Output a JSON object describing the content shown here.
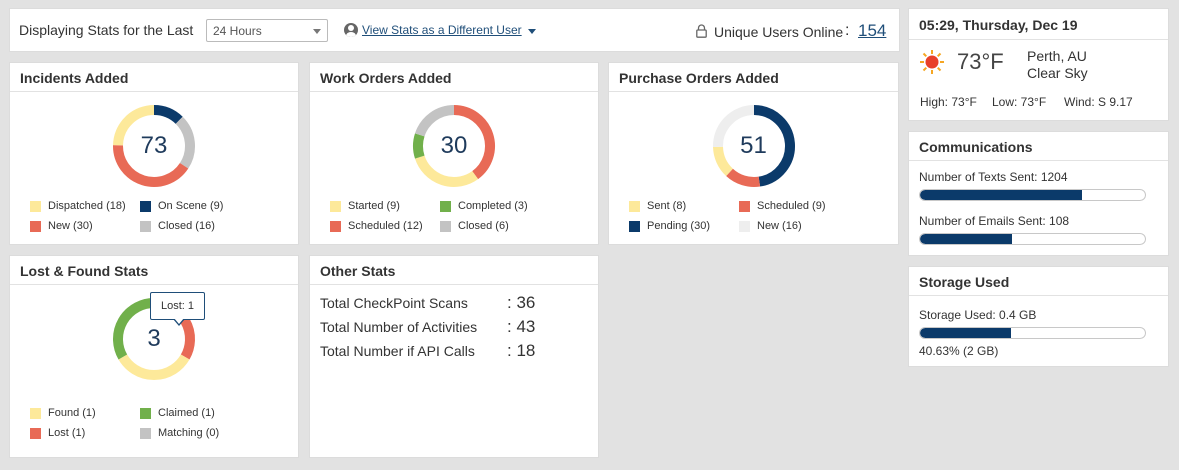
{
  "topbar": {
    "label": "Displaying Stats for the Last",
    "range_value": "24 Hours",
    "diff_user_link": "View Stats as a Different User",
    "unique_label": "Unique Users Online",
    "unique_colon": ":",
    "unique_count": "154"
  },
  "colors": {
    "yellow": "#fde99a",
    "navy": "#0b3a6a",
    "gray": "#c3c3c3",
    "red": "#e86a56",
    "green": "#71b04b",
    "lightgray": "#eeeeee"
  },
  "incidents": {
    "title": "Incidents Added",
    "total": "73",
    "legend": [
      {
        "label": "Dispatched (18)",
        "color": "#fde99a",
        "value": 18
      },
      {
        "label": "On Scene (9)",
        "color": "#0b3a6a",
        "value": 9
      },
      {
        "label": "New (30)",
        "color": "#e86a56",
        "value": 30
      },
      {
        "label": "Closed (16)",
        "color": "#c3c3c3",
        "value": 16
      }
    ]
  },
  "work_orders": {
    "title": "Work Orders Added",
    "total": "30",
    "legend": [
      {
        "label": "Started (9)",
        "color": "#fde99a",
        "value": 9
      },
      {
        "label": "Completed (3)",
        "color": "#71b04b",
        "value": 3
      },
      {
        "label": "Scheduled (12)",
        "color": "#e86a56",
        "value": 12
      },
      {
        "label": "Closed (6)",
        "color": "#c3c3c3",
        "value": 6
      }
    ]
  },
  "purchase_orders": {
    "title": "Purchase Orders Added",
    "total": "51",
    "legend": [
      {
        "label": "Sent (8)",
        "color": "#fde99a",
        "value": 8
      },
      {
        "label": "Scheduled (9)",
        "color": "#e86a56",
        "value": 9
      },
      {
        "label": "Pending (30)",
        "color": "#0b3a6a",
        "value": 30
      },
      {
        "label": "New (16)",
        "color": "#eeeeee",
        "value": 16
      }
    ]
  },
  "lost_found": {
    "title": "Lost & Found Stats",
    "total": "3",
    "tooltip": "Lost: 1",
    "legend": [
      {
        "label": "Found (1)",
        "color": "#fde99a",
        "value": 1
      },
      {
        "label": "Claimed (1)",
        "color": "#71b04b",
        "value": 1
      },
      {
        "label": "Lost (1)",
        "color": "#e86a56",
        "value": 1
      },
      {
        "label": "Matching (0)",
        "color": "#c3c3c3",
        "value": 0
      }
    ]
  },
  "other_stats": {
    "title": "Other Stats",
    "rows": [
      {
        "label": "Total CheckPoint Scans",
        "value": ": 36"
      },
      {
        "label": "Total Number of Activities",
        "value": ": 43"
      },
      {
        "label": "Total Number if API Calls",
        "value": ": 18"
      }
    ]
  },
  "weather": {
    "datetime": "05:29, Thursday, Dec 19",
    "temp": "73°F",
    "city": "Perth, AU",
    "sky": "Clear Sky",
    "icon": "sun-icon",
    "high": "High: 73°F",
    "low": "Low: 73°F",
    "wind": "Wind: S 9.17"
  },
  "communications": {
    "title": "Communications",
    "texts_label": "Number of Texts Sent: 1204",
    "texts_fraction": 0.72,
    "emails_label": "Number of Emails Sent: 108",
    "emails_fraction": 0.41
  },
  "storage": {
    "title": "Storage Used",
    "used_label": "Storage Used: 0.4 GB",
    "used_fraction": 0.4063,
    "percent_label": "40.63% (2 GB)"
  }
}
